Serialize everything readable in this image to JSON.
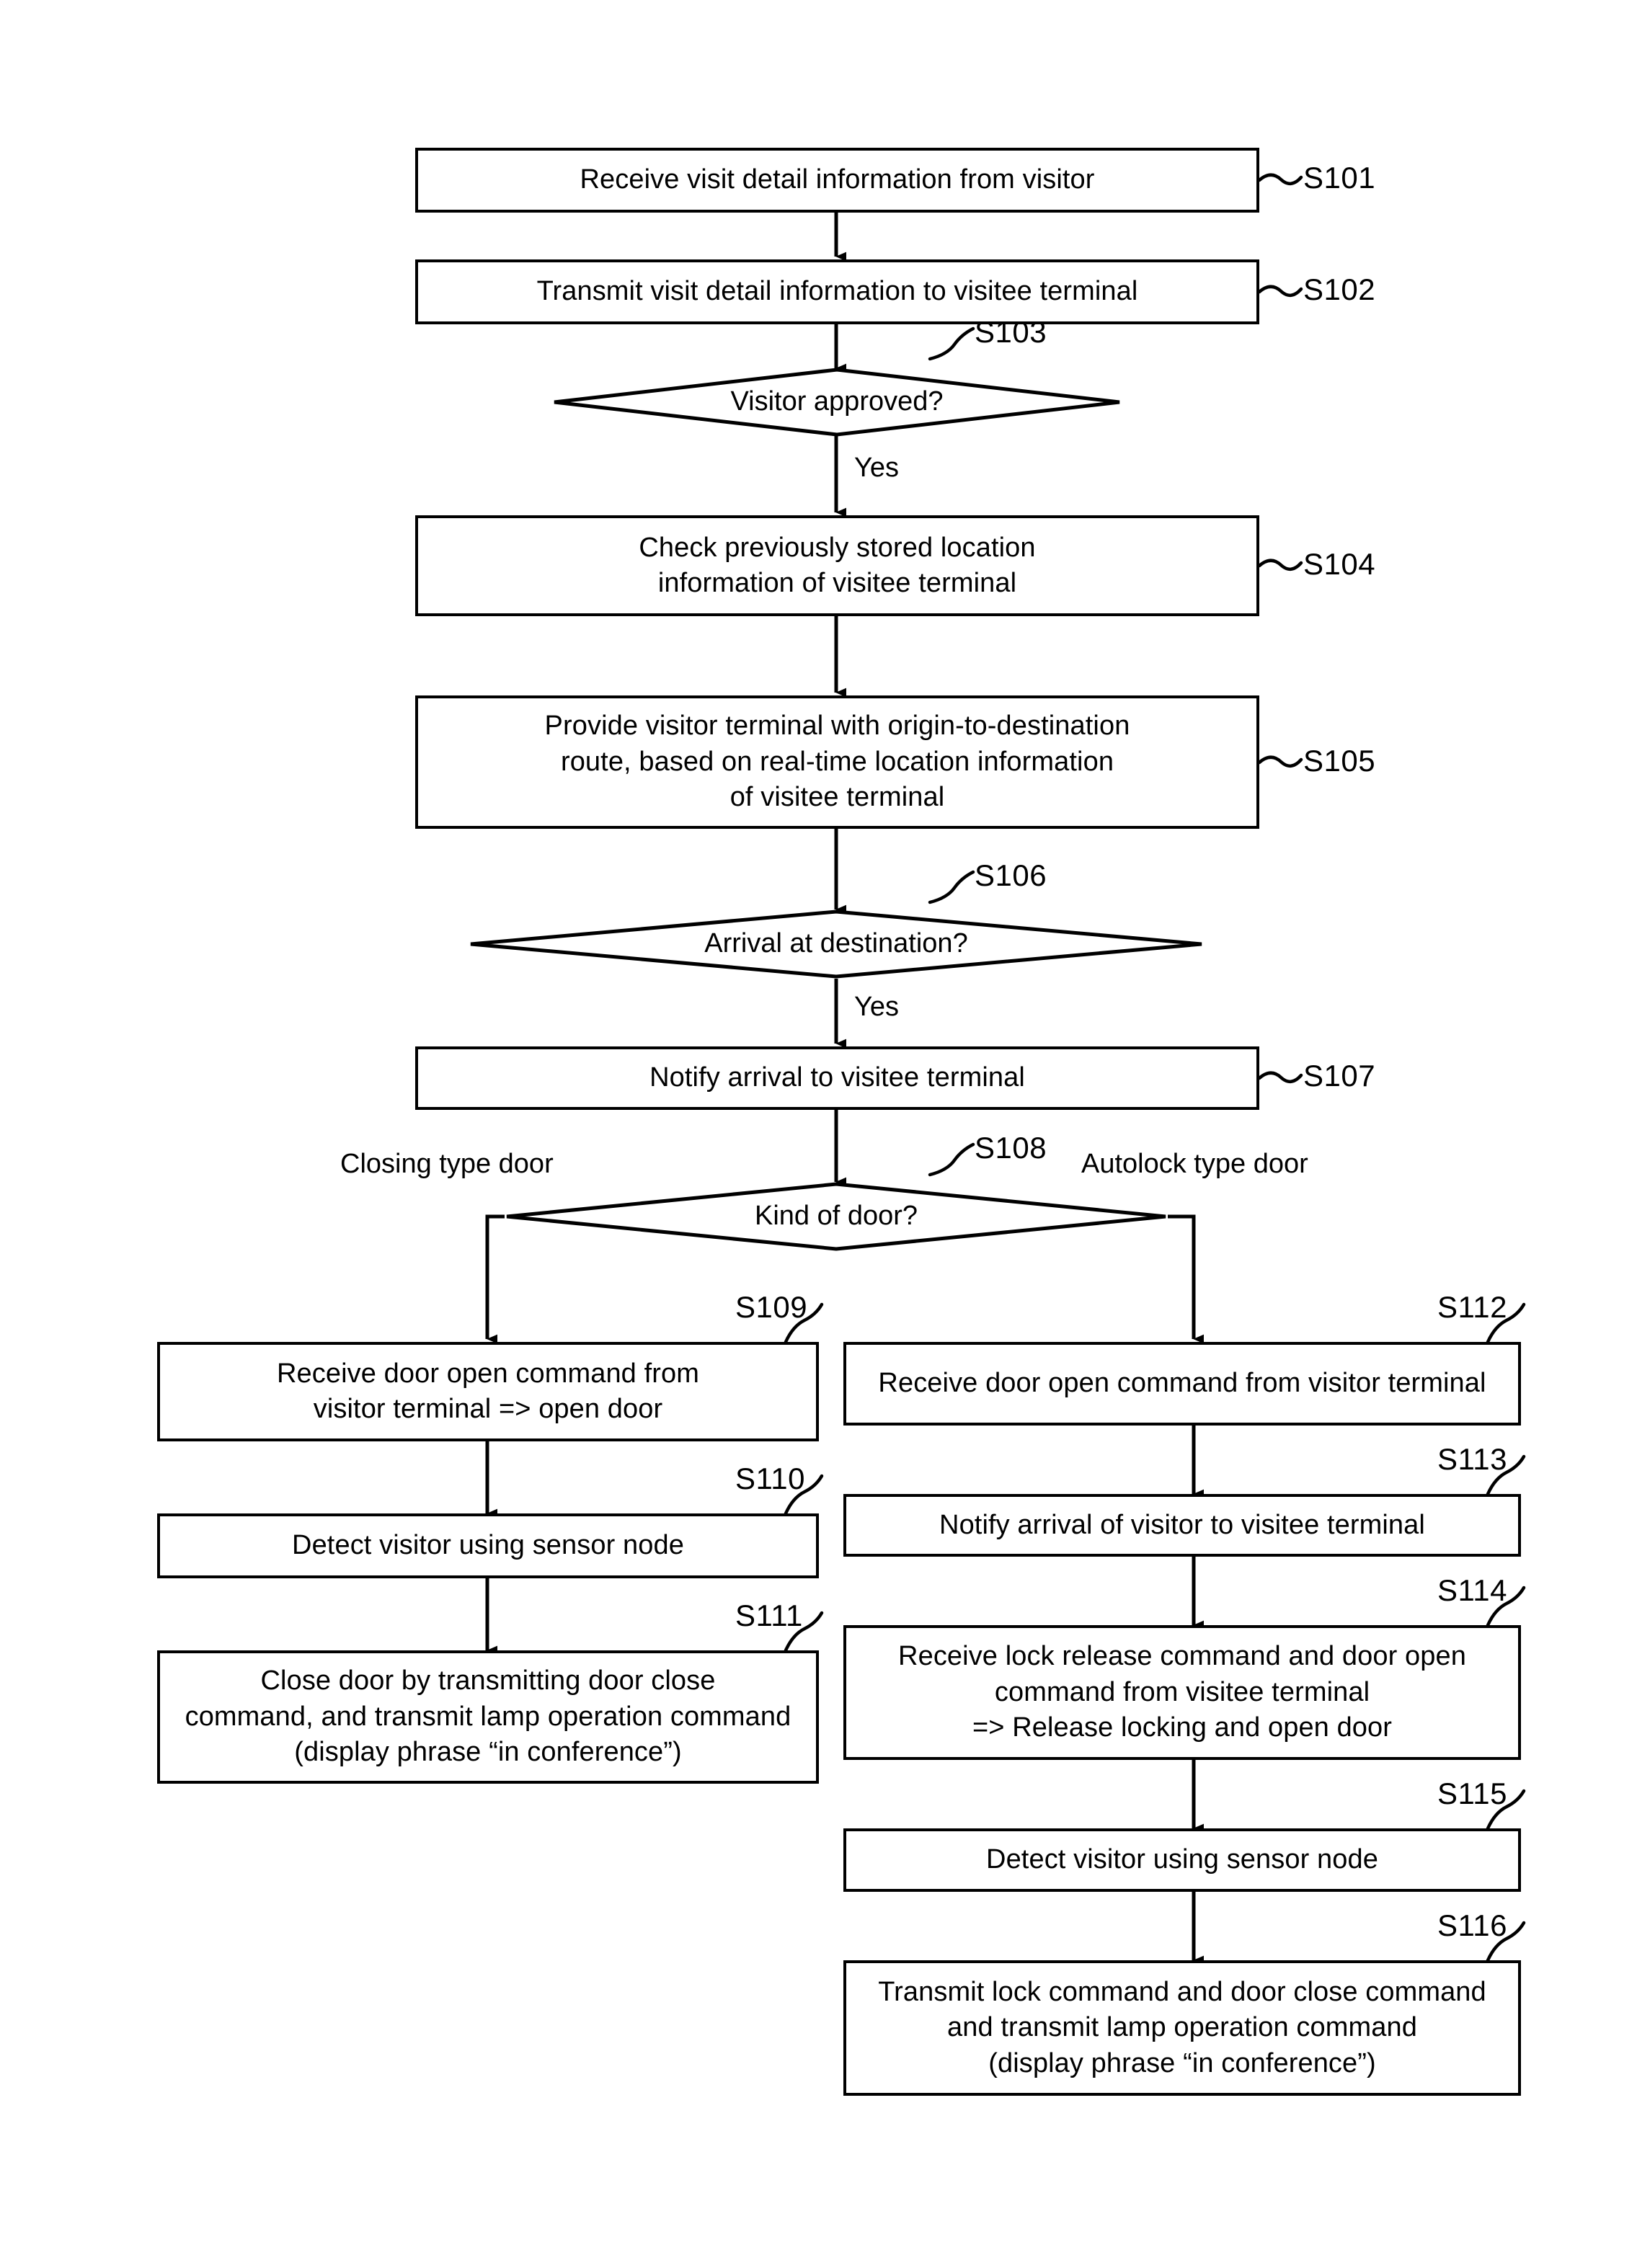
{
  "diagram": {
    "title": "Visitor access control flowchart",
    "type": "flowchart",
    "line_color": "#000000",
    "background_color": "#ffffff"
  },
  "nodes": {
    "s101": {
      "tag": "S101",
      "shape": "process",
      "lines": [
        "Receive visit detail information from visitor"
      ]
    },
    "s102": {
      "tag": "S102",
      "shape": "process",
      "lines": [
        "Transmit visit detail information to visitee terminal"
      ]
    },
    "s103": {
      "tag": "S103",
      "shape": "decision",
      "text": "Visitor approved?"
    },
    "s104": {
      "tag": "S104",
      "shape": "process",
      "lines": [
        "Check previously stored location",
        "information of visitee terminal"
      ]
    },
    "s105": {
      "tag": "S105",
      "shape": "process",
      "lines": [
        "Provide visitor terminal with origin-to-destination",
        "route, based on real-time location information",
        "of visitee terminal"
      ]
    },
    "s106": {
      "tag": "S106",
      "shape": "decision",
      "text": "Arrival at destination?"
    },
    "s107": {
      "tag": "S107",
      "shape": "process",
      "lines": [
        "Notify arrival to visitee terminal"
      ]
    },
    "s108": {
      "tag": "S108",
      "shape": "decision",
      "text": "Kind of door?"
    },
    "s109": {
      "tag": "S109",
      "shape": "process",
      "lines": [
        "Receive door open command from",
        "visitor terminal => open door"
      ]
    },
    "s110": {
      "tag": "S110",
      "shape": "process",
      "lines": [
        "Detect visitor using sensor node"
      ]
    },
    "s111": {
      "tag": "S111",
      "shape": "process",
      "lines": [
        "Close door by transmitting door close",
        "command, and transmit lamp operation command",
        "(display phrase “in conference”)"
      ]
    },
    "s112": {
      "tag": "S112",
      "shape": "process",
      "lines": [
        "Receive door open command from visitor terminal"
      ]
    },
    "s113": {
      "tag": "S113",
      "shape": "process",
      "lines": [
        "Notify arrival of visitor to visitee terminal"
      ]
    },
    "s114": {
      "tag": "S114",
      "shape": "process",
      "lines": [
        "Receive lock release command and door open",
        "command from visitee terminal",
        "=> Release locking and open door"
      ]
    },
    "s115": {
      "tag": "S115",
      "shape": "process",
      "lines": [
        "Detect visitor using sensor node"
      ]
    },
    "s116": {
      "tag": "S116",
      "shape": "process",
      "lines": [
        "Transmit lock command and door close command",
        "and transmit lamp operation command",
        "(display phrase “in conference”)"
      ]
    }
  },
  "edge_labels": {
    "s103_yes": "Yes",
    "s106_yes": "Yes",
    "s108_left": "Closing type door",
    "s108_right": "Autolock type door"
  }
}
